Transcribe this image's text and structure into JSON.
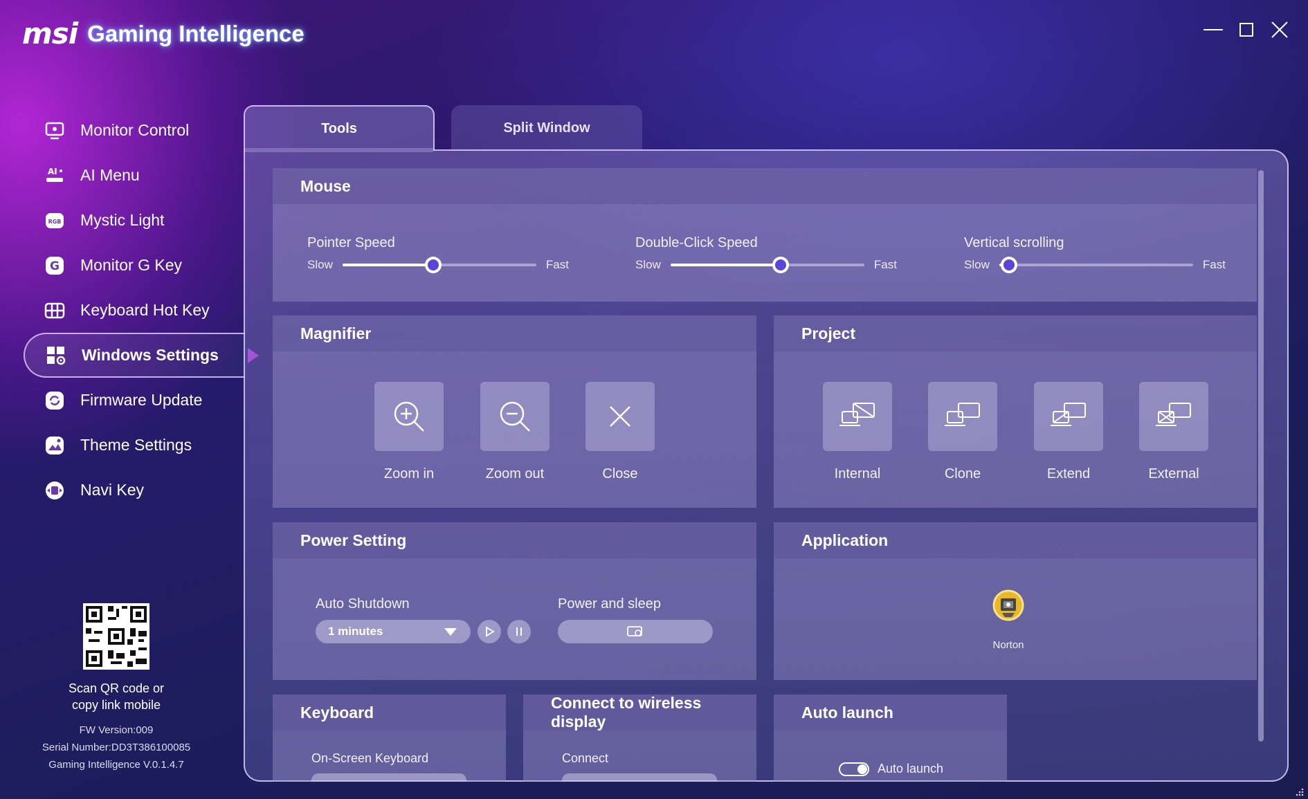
{
  "app": {
    "logo": "msi",
    "name": "Gaming Intelligence"
  },
  "window_controls": {
    "minimize_icon": "minimize-icon",
    "maximize_icon": "maximize-icon",
    "close_icon": "close-icon"
  },
  "sidebar": {
    "items": [
      {
        "label": "Monitor Control",
        "icon": "monitor-icon",
        "active": false
      },
      {
        "label": "AI Menu",
        "icon": "ai-menu-icon",
        "active": false
      },
      {
        "label": "Mystic Light",
        "icon": "rgb-icon",
        "active": false
      },
      {
        "label": "Monitor G Key",
        "icon": "g-key-icon",
        "active": false
      },
      {
        "label": "Keyboard Hot Key",
        "icon": "keyboard-icon",
        "active": false
      },
      {
        "label": "Windows Settings",
        "icon": "windows-settings-icon",
        "active": true
      },
      {
        "label": "Firmware Update",
        "icon": "firmware-icon",
        "active": false
      },
      {
        "label": "Theme Settings",
        "icon": "theme-icon",
        "active": false
      },
      {
        "label": "Navi Key",
        "icon": "navi-key-icon",
        "active": false
      }
    ],
    "qr_text_line1": "Scan QR code or",
    "qr_text_line2": "copy link mobile",
    "fw_version": "FW Version:009",
    "serial_number": "Serial Number:DD3T386100085",
    "app_version": "Gaming Intelligence V.0.1.4.7"
  },
  "tabs": [
    {
      "label": "Tools",
      "active": true
    },
    {
      "label": "Split Window",
      "active": false
    }
  ],
  "mouse": {
    "title": "Mouse",
    "sliders": [
      {
        "label": "Pointer Speed",
        "min_label": "Slow",
        "max_label": "Fast",
        "value_fraction": 0.47
      },
      {
        "label": "Double-Click Speed",
        "min_label": "Slow",
        "max_label": "Fast",
        "value_fraction": 0.57
      },
      {
        "label": "Vertical scrolling",
        "min_label": "Slow",
        "max_label": "Fast",
        "value_fraction": 0.05
      }
    ]
  },
  "magnifier": {
    "title": "Magnifier",
    "buttons": [
      {
        "label": "Zoom in",
        "icon": "zoom-in-icon"
      },
      {
        "label": "Zoom out",
        "icon": "zoom-out-icon"
      },
      {
        "label": "Close",
        "icon": "close-icon"
      }
    ]
  },
  "project": {
    "title": "Project",
    "buttons": [
      {
        "label": "Internal",
        "icon": "project-internal-icon"
      },
      {
        "label": "Clone",
        "icon": "project-clone-icon"
      },
      {
        "label": "Extend",
        "icon": "project-extend-icon"
      },
      {
        "label": "External",
        "icon": "project-external-icon"
      }
    ]
  },
  "power": {
    "title": "Power Setting",
    "auto_shutdown_label": "Auto Shutdown",
    "auto_shutdown_value": "1 minutes",
    "power_sleep_label": "Power and sleep"
  },
  "application": {
    "title": "Application",
    "apps": [
      {
        "label": "Norton",
        "icon": "norton-icon"
      }
    ]
  },
  "keyboard": {
    "title": "Keyboard",
    "onscreen_label": "On-Screen Keyboard"
  },
  "wireless": {
    "title": "Connect to wireless display",
    "connect_label": "Connect"
  },
  "auto_launch": {
    "title": "Auto launch",
    "toggle_label": "Auto launch",
    "enabled": true
  },
  "colors": {
    "accent": "#5a45d8",
    "pointer": "#d83cf5",
    "glow": "#78aaff"
  }
}
